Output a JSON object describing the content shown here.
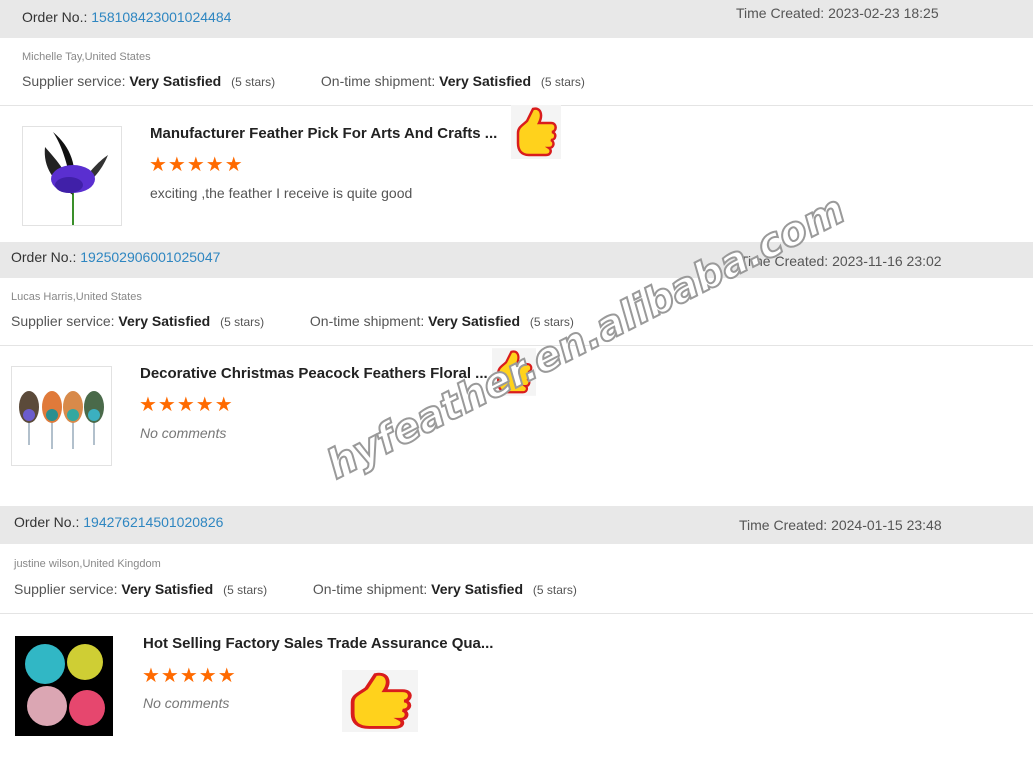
{
  "orders": [
    {
      "order_label": "Order No.:",
      "order_no": "158108423001024484",
      "time_label": "Time Created:",
      "time": "2023-02-23 18:25",
      "buyer": "Michelle Tay,United States",
      "supplier_label": "Supplier service:",
      "supplier_value": "Very Satisfied",
      "supplier_stars": "(5 stars)",
      "shipment_label": "On-time shipment:",
      "shipment_value": "Very Satisfied",
      "shipment_stars": "(5 stars)",
      "product_title": "Manufacturer Feather Pick For Arts And Crafts ...",
      "rating_stars": "★★★★★",
      "rating": 5,
      "comment": "exciting ,the feather I receive is quite good"
    },
    {
      "order_label": "Order No.:",
      "order_no": "192502906001025047",
      "time_label": "Time Created:",
      "time": "2023-11-16 23:02",
      "buyer": "Lucas Harris,United States",
      "supplier_label": "Supplier service:",
      "supplier_value": "Very Satisfied",
      "supplier_stars": "(5 stars)",
      "shipment_label": "On-time shipment:",
      "shipment_value": "Very Satisfied",
      "shipment_stars": "(5 stars)",
      "product_title": "Decorative Christmas Peacock Feathers Floral ...",
      "rating_stars": "★★★★★",
      "rating": 5,
      "comment": "No comments"
    },
    {
      "order_label": "Order No.:",
      "order_no": "194276214501020826",
      "time_label": "Time Created:",
      "time": "2024-01-15 23:48",
      "buyer": "justine wilson,United Kingdom",
      "supplier_label": "Supplier service:",
      "supplier_value": "Very Satisfied",
      "supplier_stars": "(5 stars)",
      "shipment_label": "On-time shipment:",
      "shipment_value": "Very Satisfied",
      "shipment_stars": "(5 stars)",
      "product_title": "Hot Selling Factory Sales Trade Assurance Qua...",
      "rating_stars": "★★★★★",
      "rating": 5,
      "comment": "No comments"
    }
  ],
  "watermark": "hyfeather.en.alibaba.com",
  "colors": {
    "link": "#2e86c1",
    "star": "#ff6a00",
    "header_bg": "#e8e8e8"
  }
}
